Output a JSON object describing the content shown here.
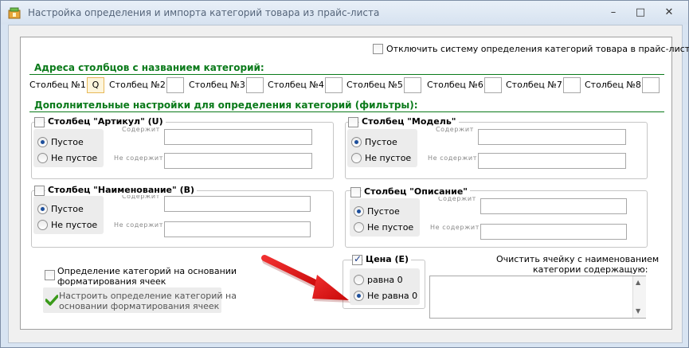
{
  "window": {
    "title": "Настройка определения и импорта категорий товара из прайс-листа",
    "minimize": "–",
    "maximize": "□",
    "close": "✕"
  },
  "disable_system": {
    "label": "Отключить систему определения категорий товара в прайс-листе",
    "checked": false
  },
  "section_columns": {
    "title": "Адреса столбцов с названием категорий:"
  },
  "columns": [
    {
      "label": "Столбец №1:",
      "value": "Q"
    },
    {
      "label": "Столбец №2:",
      "value": ""
    },
    {
      "label": "Столбец №3:",
      "value": ""
    },
    {
      "label": "Столбец №4:",
      "value": ""
    },
    {
      "label": "Столбец №5:",
      "value": ""
    },
    {
      "label": "Столбец №6:",
      "value": ""
    },
    {
      "label": "Столбец №7:",
      "value": ""
    },
    {
      "label": "Столбец №8:",
      "value": ""
    }
  ],
  "section_filters": {
    "title": "Дополнительные настройки для определения категорий (фильтры):"
  },
  "filters": {
    "article": {
      "title": "Столбец \"Артикул\" (U)",
      "empty": "Пустое",
      "not_empty": "Не пустое",
      "selected": "empty",
      "contains": "Содержит",
      "not_contains": "Не содержит"
    },
    "model": {
      "title": "Столбец \"Модель\"",
      "empty": "Пустое",
      "not_empty": "Не пустое",
      "selected": "empty",
      "contains": "Содержит",
      "not_contains": "Не содержит"
    },
    "name": {
      "title": "Столбец \"Наименование\" (B)",
      "empty": "Пустое",
      "not_empty": "Не пустое",
      "selected": "empty",
      "contains": "Содержит",
      "not_contains": "Не содержит"
    },
    "description": {
      "title": "Столбец \"Описание\"",
      "empty": "Пустое",
      "not_empty": "Не пустое",
      "selected": "empty",
      "contains": "Содержит",
      "not_contains": "Не содержит"
    }
  },
  "formatting": {
    "checkbox_label_line1": "Определение категорий на основании",
    "checkbox_label_line2": "форматирования ячеек",
    "button_line1": "Настроить определение категорий на",
    "button_line2": "основании форматирования ячеек"
  },
  "price": {
    "title": "Цена (E)",
    "checked": true,
    "equals_zero": "равна 0",
    "not_equals_zero": "Не равна 0",
    "selected": "not_equals_zero"
  },
  "clear_cell": {
    "label_line1": "Очистить ячейку с наименованием",
    "label_line2": "категории содержащую:",
    "value": ""
  },
  "colors": {
    "section_green": "#0a7a1a",
    "arrow_red": "#e01010"
  }
}
